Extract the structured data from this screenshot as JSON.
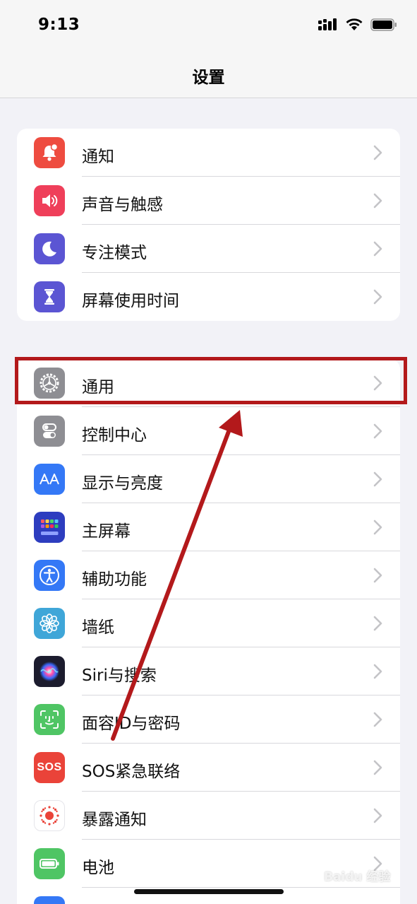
{
  "status_bar": {
    "time": "9:13",
    "icons": [
      "cellular-signal-icon",
      "wifi-icon",
      "battery-icon"
    ]
  },
  "nav": {
    "title": "设置"
  },
  "groups": [
    {
      "items": [
        {
          "label": "通知",
          "icon": "notification-bell-icon",
          "color": "#ee4c40"
        },
        {
          "label": "声音与触感",
          "icon": "speaker-icon",
          "color": "#ef3f5a"
        },
        {
          "label": "专注模式",
          "icon": "moon-icon",
          "color": "#5b55d3"
        },
        {
          "label": "屏幕使用时间",
          "icon": "hourglass-icon",
          "color": "#5b55d3"
        }
      ]
    },
    {
      "items": [
        {
          "label": "通用",
          "icon": "gear-icon",
          "color": "#8e8e93"
        },
        {
          "label": "控制中心",
          "icon": "toggles-icon",
          "color": "#8e8e93"
        },
        {
          "label": "显示与亮度",
          "icon": "text-size-icon",
          "color": "#3478f6"
        },
        {
          "label": "主屏幕",
          "icon": "app-grid-icon",
          "color": "#2d3dbf"
        },
        {
          "label": "辅助功能",
          "icon": "accessibility-icon",
          "color": "#3478f6"
        },
        {
          "label": "墙纸",
          "icon": "flower-icon",
          "color": "#3fa6d8"
        },
        {
          "label": "Siri与搜索",
          "icon": "siri-icon",
          "color": "#1c1c2e"
        },
        {
          "label": "面容ID与密码",
          "icon": "face-id-icon",
          "color": "#4fc564"
        },
        {
          "label": "SOS紧急联络",
          "icon": "sos-icon",
          "color": "#ea4339",
          "icon_text": "SOS"
        },
        {
          "label": "暴露通知",
          "icon": "exposure-icon",
          "color": "#ffffff"
        },
        {
          "label": "电池",
          "icon": "battery-icon",
          "color": "#4fc564"
        }
      ]
    }
  ],
  "annotation": {
    "highlight_color": "#b3191b",
    "highlighted_item": "通用"
  },
  "watermark": {
    "text": "Baidu 经验"
  }
}
